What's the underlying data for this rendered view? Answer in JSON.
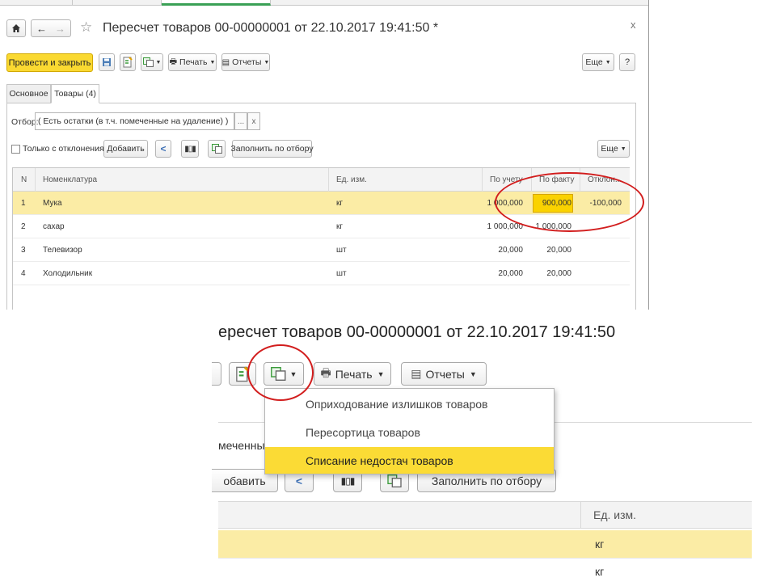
{
  "window": {
    "title": "Пересчет товаров 00-00000001 от 22.10.2017 19:41:50 *",
    "close": "x"
  },
  "toolbar": {
    "post_close": "Провести и закрыть",
    "print": "Печать",
    "reports": "Отчеты",
    "more": "Еще",
    "help": "?"
  },
  "tabs": [
    "Основное",
    "Товары (4)"
  ],
  "filter": {
    "label": "Отбор:",
    "value": "( Есть остатки (в т.ч. помеченные на удаление) )",
    "ellipsis": "...",
    "clear": "x"
  },
  "list_toolbar": {
    "only_deviations": "Только с отклонениями",
    "add": "Добавить",
    "fill_by_filter": "Заполнить по отбору",
    "more": "Еще"
  },
  "table": {
    "columns": [
      "N",
      "Номенклатура",
      "Ед. изм.",
      "По учету",
      "По факту",
      "Отклон..."
    ],
    "rows": [
      {
        "n": "1",
        "name": "Мука",
        "unit": "кг",
        "book": "1 000,000",
        "fact": "900,000",
        "dev": "-100,000"
      },
      {
        "n": "2",
        "name": "сахар",
        "unit": "кг",
        "book": "1 000,000",
        "fact": "1 000,000",
        "dev": ""
      },
      {
        "n": "3",
        "name": "Телевизор",
        "unit": "шт",
        "book": "20,000",
        "fact": "20,000",
        "dev": ""
      },
      {
        "n": "4",
        "name": "Холодильник",
        "unit": "шт",
        "book": "20,000",
        "fact": "20,000",
        "dev": ""
      }
    ]
  },
  "zoom": {
    "title": "ересчет товаров 00-00000001 от 22.10.2017 19:41:50",
    "print": "Печать",
    "reports": "Отчеты",
    "menu_items": [
      "Оприходование излишков товаров",
      "Пересортица товаров",
      "Списание недостач товаров"
    ],
    "partial_filter": "меченны",
    "partial_add": "обавить",
    "fill_by_filter": "Заполнить по отбору",
    "unit_header": "Ед. изм.",
    "row1_unit": "кг",
    "row2_unit": "кг"
  }
}
